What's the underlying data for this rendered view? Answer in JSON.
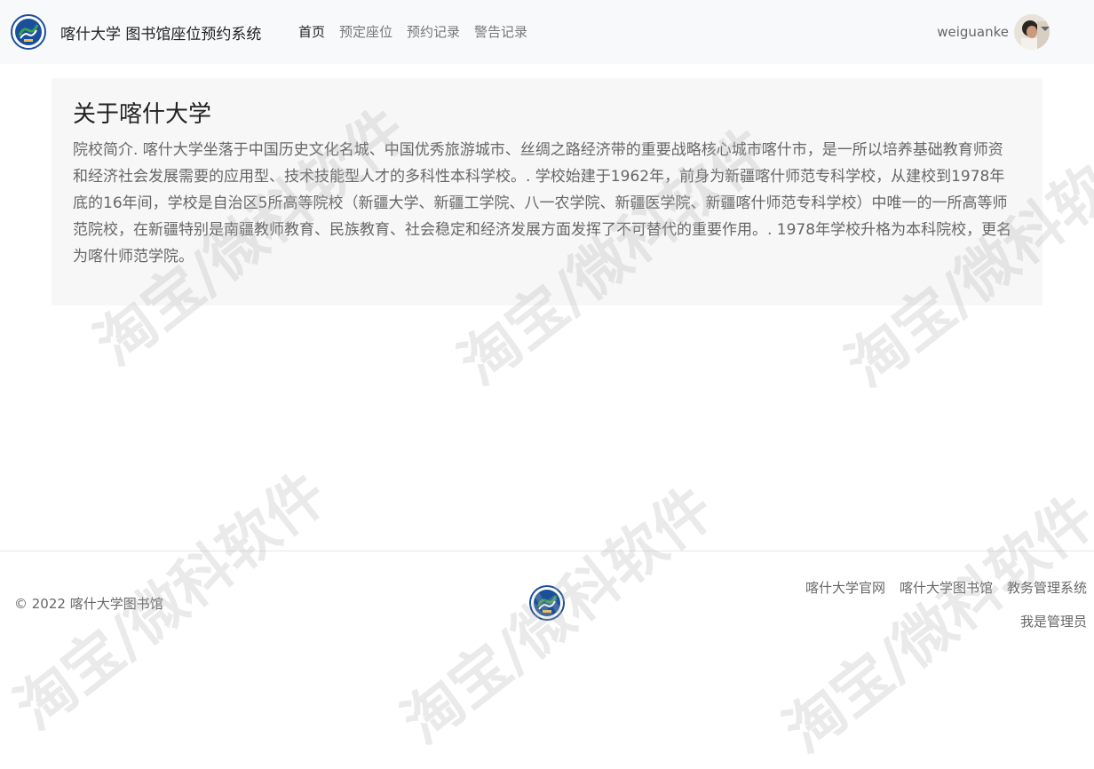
{
  "navbar": {
    "brand_text": "喀什大学 图书馆座位预约系统",
    "links": [
      {
        "label": "首页"
      },
      {
        "label": "预定座位"
      },
      {
        "label": "预约记录"
      },
      {
        "label": "警告记录"
      }
    ],
    "user": {
      "username": "weiguanke"
    }
  },
  "main": {
    "title": "关于喀什大学",
    "paragraph": "院校简介. 喀什大学坐落于中国历史文化名城、中国优秀旅游城市、丝绸之路经济带的重要战略核心城市喀什市，是一所以培养基础教育师资和经济社会发展需要的应用型、技术技能型人才的多科性本科学校。. 学校始建于1962年，前身为新疆喀什师范专科学校，从建校到1978年底的16年间，学校是自治区5所高等院校（新疆大学、新疆工学院、八一农学院、新疆医学院、新疆喀什师范专科学校）中唯一的一所高等师范院校，在新疆特别是南疆教师教育、民族教育、社会稳定和经济发展方面发挥了不可替代的重要作用。. 1978年学校升格为本科院校，更名为喀什师范学院。"
  },
  "footer": {
    "copyright": "© 2022 喀什大学图书馆",
    "links": [
      {
        "label": "喀什大学官网"
      },
      {
        "label": "喀什大学图书馆"
      },
      {
        "label": "教务管理系统"
      }
    ],
    "admin_link": "我是管理员"
  },
  "watermark": {
    "text": "淘宝/微科软件"
  },
  "colors": {
    "navbar_bg": "#f8f9fa",
    "jumbotron_bg": "#f7f7f7",
    "logo_blue": "#1a4f9c",
    "logo_green": "#3aa14a"
  }
}
